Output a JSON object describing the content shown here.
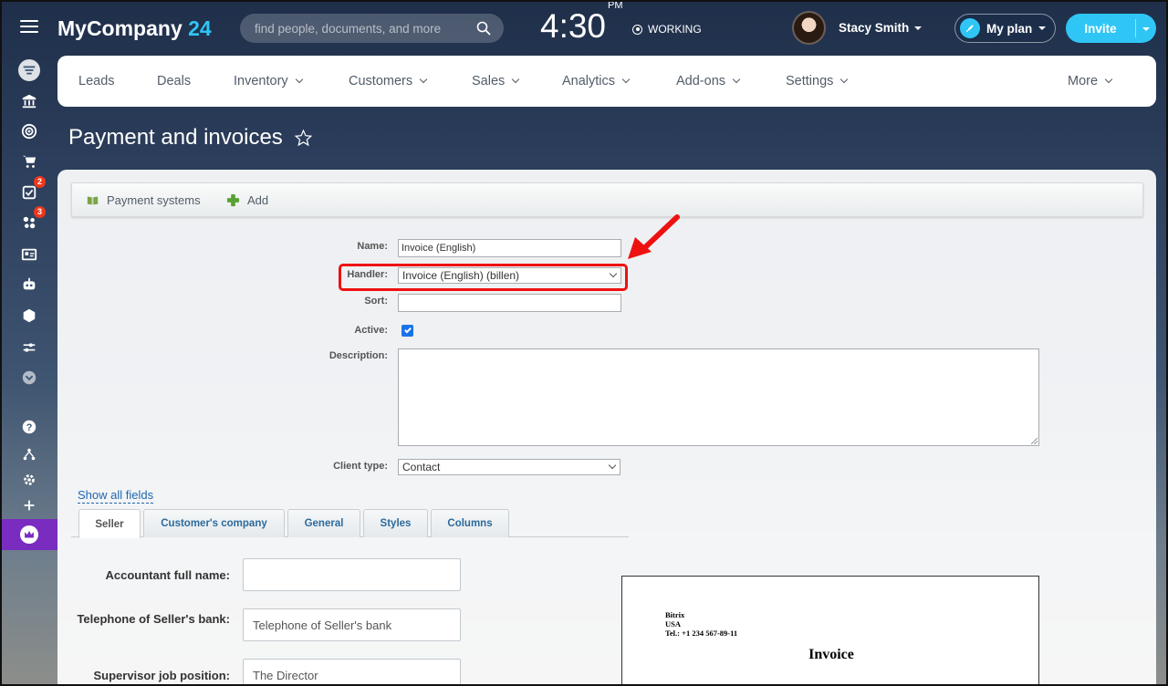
{
  "header": {
    "logo_name": "MyCompany",
    "logo_num": "24",
    "search_placeholder": "find people, documents, and more",
    "clock": "4:30",
    "clock_suffix": "PM",
    "status": "WORKING",
    "user_name": "Stacy Smith",
    "plan_label": "My plan",
    "invite_label": "Invite"
  },
  "sidebar": {
    "badges": {
      "tasks": "2",
      "feed": "3"
    }
  },
  "nav": {
    "items": [
      "Leads",
      "Deals",
      "Inventory",
      "Customers",
      "Sales",
      "Analytics",
      "Add-ons",
      "Settings",
      "More"
    ]
  },
  "page": {
    "title": "Payment and invoices"
  },
  "toolbar": {
    "payment_systems": "Payment systems",
    "add": "Add"
  },
  "form": {
    "name_label": "Name:",
    "name_value": "Invoice (English)",
    "handler_label": "Handler:",
    "handler_value": "Invoice (English) (billen)",
    "sort_label": "Sort:",
    "sort_value": "",
    "active_label": "Active:",
    "description_label": "Description:",
    "client_type_label": "Client type:",
    "client_type_value": "Contact",
    "show_all": "Show all fields"
  },
  "tabs": [
    "Seller",
    "Customer's company",
    "General",
    "Styles",
    "Columns"
  ],
  "seller": {
    "accountant_label": "Accountant full name:",
    "accountant_value": "",
    "bank_phone_label": "Telephone of Seller's bank:",
    "bank_phone_placeholder": "Telephone of Seller's bank",
    "supervisor_label": "Supervisor job position:",
    "supervisor_value": "The Director"
  },
  "invoice_preview": {
    "company": "Bitrix",
    "country": "USA",
    "phone": "Tel.: +1 234 567-89-11",
    "title": "Invoice"
  },
  "colors": {
    "accent": "#2fc6f6",
    "highlight": "#ee1111",
    "link": "#2067b0",
    "crown_bg": "#7a2bc0"
  }
}
